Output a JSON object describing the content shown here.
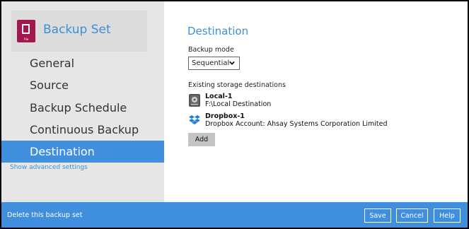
{
  "sidebar": {
    "title": "Backup Set",
    "icon_caption": "File",
    "items": [
      {
        "label": "General"
      },
      {
        "label": "Source"
      },
      {
        "label": "Backup Schedule"
      },
      {
        "label": "Continuous Backup"
      },
      {
        "label": "Destination"
      }
    ],
    "active_item": "Destination",
    "advanced_link": "Show advanced settings"
  },
  "main": {
    "title": "Destination",
    "backup_mode_label": "Backup mode",
    "backup_mode_value": "Sequential",
    "existing_label": "Existing storage destinations",
    "destinations": [
      {
        "name": "Local-1",
        "detail": "F:\\Local Destination",
        "icon": "local-drive-icon"
      },
      {
        "name": "Dropbox-1",
        "detail": "Dropbox Account: Ahsay Systems Corporation Limited",
        "icon": "dropbox-icon"
      }
    ],
    "add_label": "Add"
  },
  "footer": {
    "delete_label": "Delete this backup set",
    "save_label": "Save",
    "cancel_label": "Cancel",
    "help_label": "Help"
  },
  "colors": {
    "accent": "#3f8fde",
    "brand_icon": "#a3174f",
    "sidebar_bg": "#e6e6e6"
  }
}
